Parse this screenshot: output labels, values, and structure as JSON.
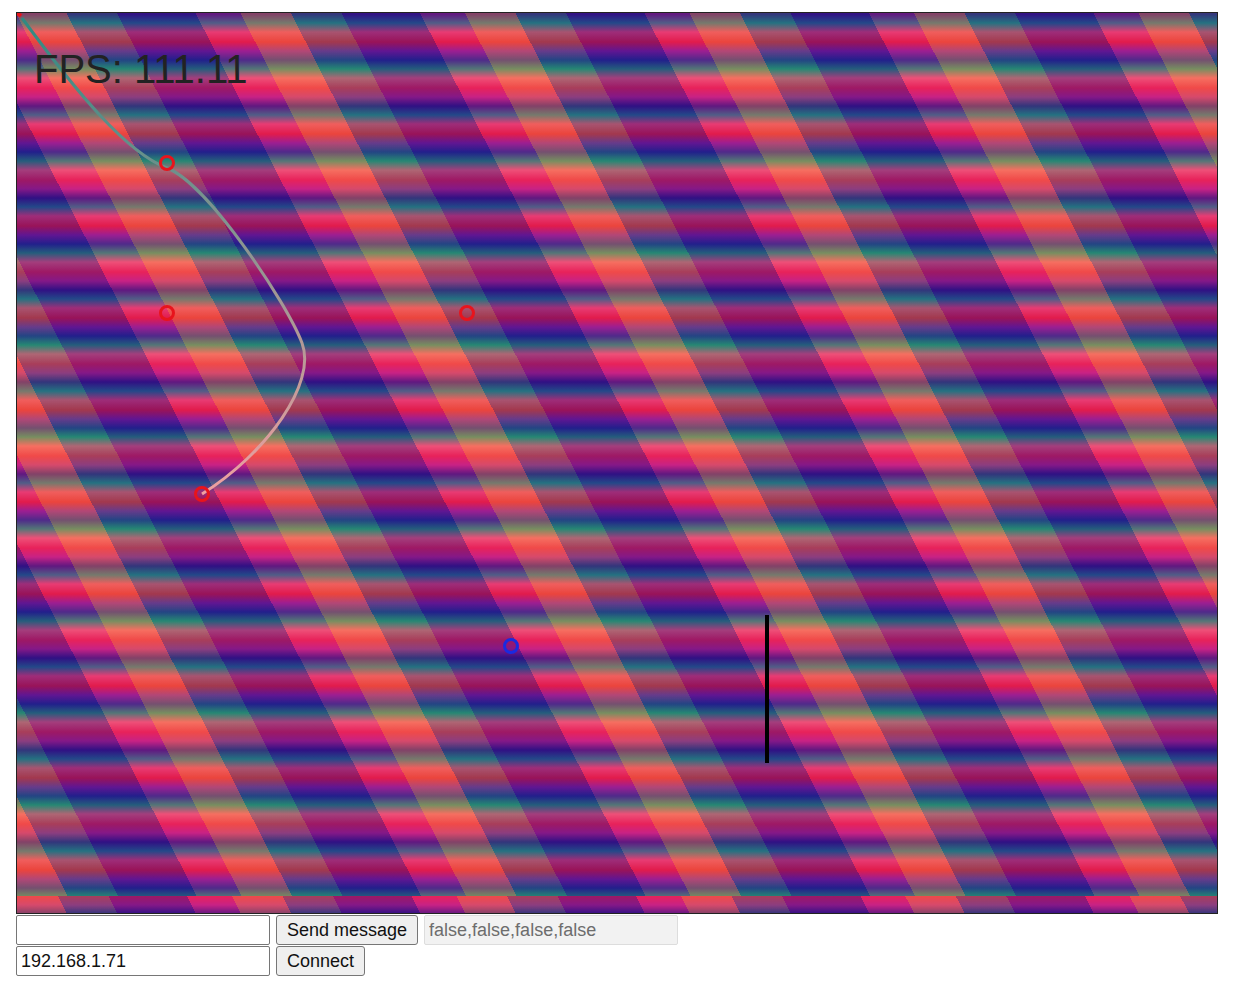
{
  "canvas": {
    "fps": "FPS: 111.11",
    "markers": [
      {
        "color": "#e8141c"
      },
      {
        "color": "#e8141c"
      },
      {
        "color": "#e8141c"
      },
      {
        "color": "#e8141c"
      },
      {
        "color": "#1a2ae0"
      }
    ]
  },
  "message_input": {
    "value": ""
  },
  "send_button": {
    "label": "Send message"
  },
  "status_field": {
    "value": "false,false,false,false",
    "disabled": true
  },
  "address_input": {
    "value": "192.168.1.71"
  },
  "connect_button": {
    "label": "Connect"
  }
}
